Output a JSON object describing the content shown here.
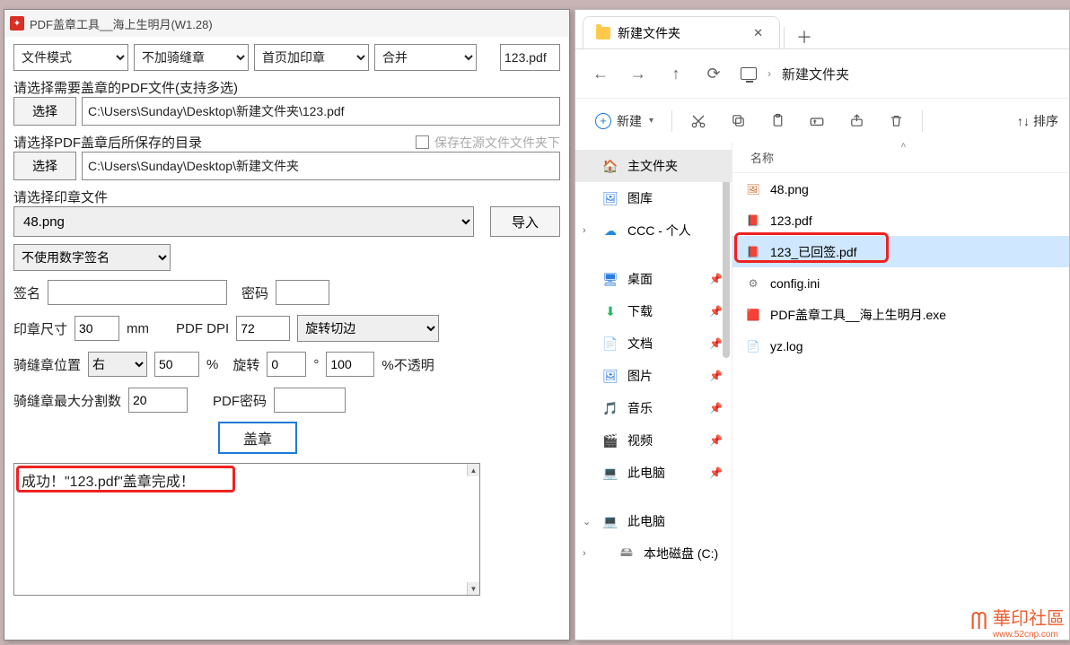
{
  "pdf_tool": {
    "title": "PDF盖章工具__海上生明月(W1.28)",
    "topCombos": {
      "mode": "文件模式",
      "riding": "不加骑缝章",
      "firstPage": "首页加印章",
      "merge": "合并"
    },
    "currentFile": "123.pdf",
    "labels": {
      "selectPdf": "请选择需要盖章的PDF文件(支持多选)",
      "select": "选择",
      "pdfPath": "C:\\Users\\Sunday\\Desktop\\新建文件夹\\123.pdf",
      "selectOutDir": "请选择PDF盖章后所保存的目录",
      "saveInSource": "保存在源文件文件夹下",
      "outPath": "C:\\Users\\Sunday\\Desktop\\新建文件夹",
      "selectSeal": "请选择印章文件",
      "sealFile": "48.png",
      "import": "导入",
      "noDigitalSig": "不使用数字签名",
      "sigLabel": "签名",
      "pwdLabel": "密码",
      "sealSize": "印章尺寸",
      "sealSizeVal": "30",
      "mm": "mm",
      "dpi": "PDF DPI",
      "dpiVal": "72",
      "rotation": "旋转切边",
      "ridingPos": "骑缝章位置",
      "ridingPosVal": "右",
      "ridingNum": "50",
      "pct": "%",
      "rotLabel": "旋转",
      "rotVal": "0",
      "deg": "°",
      "opacityVal": "100",
      "opacityLabel": "%不透明",
      "maxSplit": "骑缝章最大分割数",
      "maxSplitVal": "20",
      "pdfPwd": "PDF密码",
      "stampBtn": "盖章",
      "result": "成功！\"123.pdf\"盖章完成！"
    }
  },
  "explorer": {
    "tabTitle": "新建文件夹",
    "nav": {
      "addressFolder": "新建文件夹"
    },
    "toolbar": {
      "new": "新建",
      "sort": "排序"
    },
    "sidebar": [
      {
        "key": "home",
        "label": "主文件夹",
        "icon": "🏠",
        "cls": "ico-home",
        "selected": true
      },
      {
        "key": "gallery",
        "label": "图库",
        "icon": "🖼",
        "cls": "ico-gallery"
      },
      {
        "key": "ccc",
        "label": "CCC - 个人",
        "icon": "☁",
        "cls": "ico-cloud",
        "expandable": true
      },
      {
        "spacer": true
      },
      {
        "key": "desktop",
        "label": "桌面",
        "icon": "🖥",
        "cls": "ico-desk",
        "pinned": true
      },
      {
        "key": "downloads",
        "label": "下载",
        "icon": "⬇",
        "cls": "ico-down",
        "pinned": true
      },
      {
        "key": "documents",
        "label": "文档",
        "icon": "📄",
        "cls": "ico-doc2",
        "pinned": true
      },
      {
        "key": "pictures",
        "label": "图片",
        "icon": "🖼",
        "cls": "ico-pic",
        "pinned": true
      },
      {
        "key": "music",
        "label": "音乐",
        "icon": "🎵",
        "cls": "ico-music",
        "pinned": true
      },
      {
        "key": "videos",
        "label": "视频",
        "icon": "🎬",
        "cls": "ico-video",
        "pinned": true
      },
      {
        "key": "thispc-pin",
        "label": "此电脑",
        "icon": "💻",
        "cls": "ico-pc",
        "pinned": true
      },
      {
        "spacer": true
      },
      {
        "key": "thispc",
        "label": "此电脑",
        "icon": "💻",
        "cls": "ico-pc",
        "expandable": true,
        "expanded": true
      },
      {
        "key": "diskc",
        "label": "本地磁盘 (C:)",
        "icon": "🖴",
        "cls": "ico-disk",
        "level": 2,
        "expandable": true
      }
    ],
    "columnHeader": "名称",
    "files": [
      {
        "name": "48.png",
        "type": "image"
      },
      {
        "name": "123.pdf",
        "type": "pdf"
      },
      {
        "name": "123_已回签.pdf",
        "type": "pdf",
        "highlighted": true,
        "selected": true
      },
      {
        "name": "config.ini",
        "type": "ini"
      },
      {
        "name": "PDF盖章工具__海上生明月.exe",
        "type": "exe"
      },
      {
        "name": "yz.log",
        "type": "text"
      }
    ]
  },
  "watermark": {
    "text": "華印社區",
    "sub": "www.52cnp.com"
  }
}
